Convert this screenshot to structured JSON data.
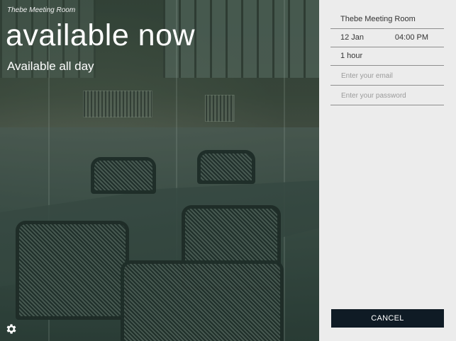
{
  "room": {
    "name": "Thebe Meeting Room",
    "status": "available now",
    "availability": "Available all day"
  },
  "form": {
    "room_field": "Thebe Meeting Room",
    "date": "12 Jan",
    "time": "04:00 PM",
    "duration": "1 hour",
    "email_placeholder": "Enter your email",
    "password_placeholder": "Enter your password",
    "cancel_label": "CANCEL"
  },
  "icons": {
    "settings": "gear-icon"
  },
  "colors": {
    "panel_bg": "#ececec",
    "button_bg": "#0f1b25",
    "overlay_tint": "#284640"
  }
}
